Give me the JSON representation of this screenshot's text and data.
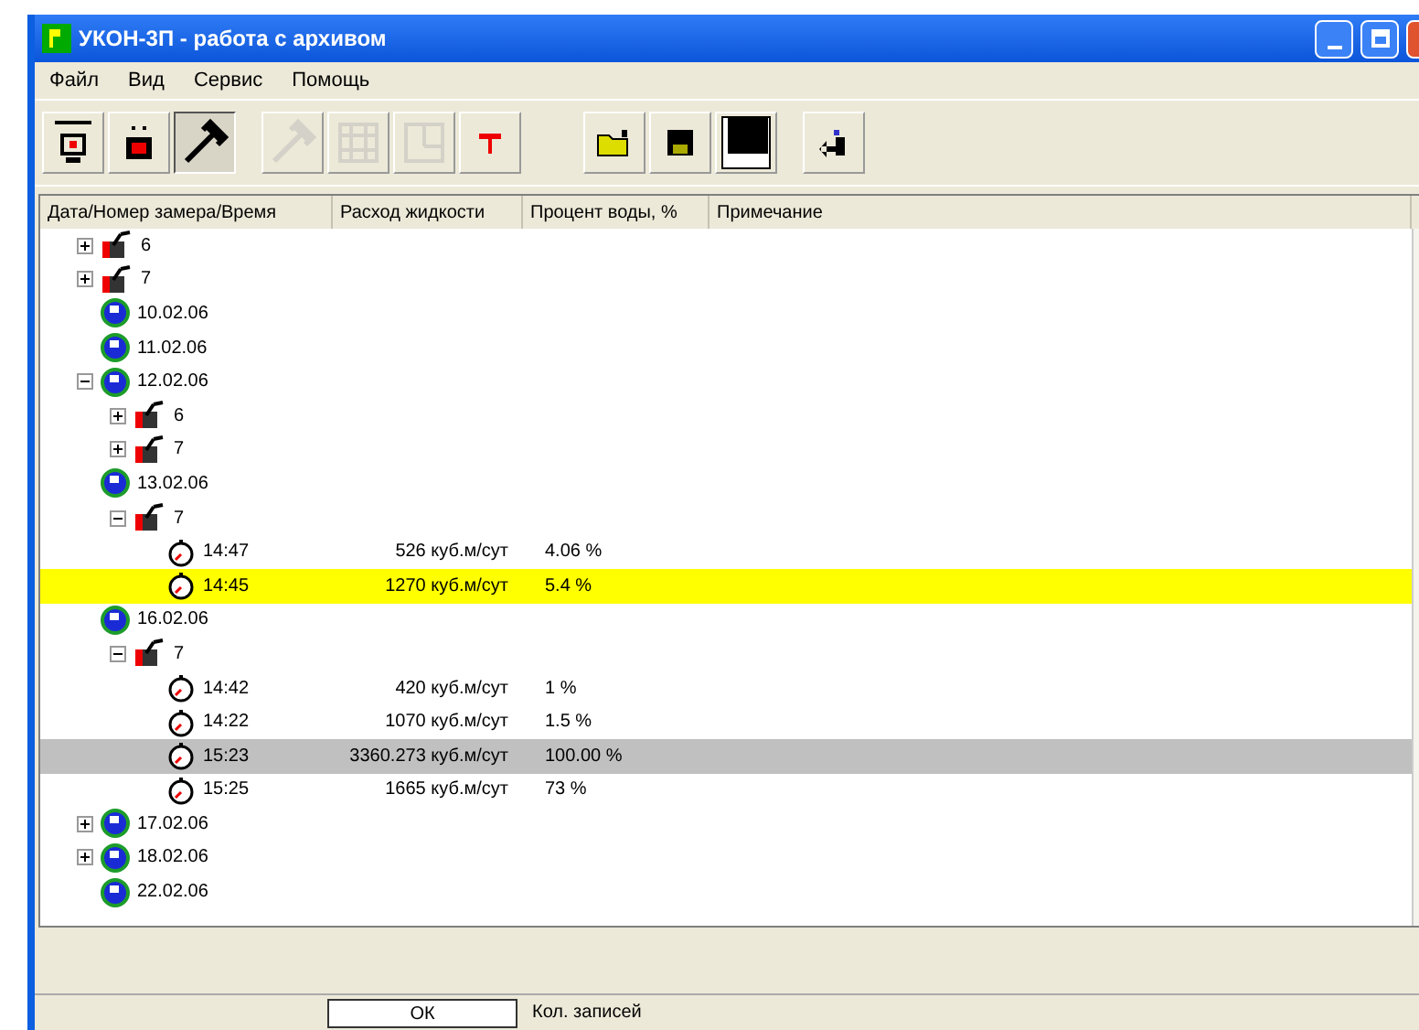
{
  "window": {
    "title": "УКОН-3П - работа с архивом"
  },
  "menu": [
    "Файл",
    "Вид",
    "Сервис",
    "Помощь"
  ],
  "toolbar": [
    {
      "kind": "device",
      "pressed": false,
      "disabled": false
    },
    {
      "kind": "battery",
      "pressed": false,
      "disabled": false
    },
    {
      "kind": "tools",
      "pressed": true,
      "disabled": false
    },
    {
      "kind": "tools",
      "pressed": false,
      "disabled": true
    },
    {
      "kind": "grid",
      "pressed": false,
      "disabled": true
    },
    {
      "kind": "frame",
      "pressed": false,
      "disabled": true
    },
    {
      "kind": "text",
      "pressed": false,
      "disabled": false
    },
    {
      "kind": "open",
      "pressed": false,
      "disabled": false
    },
    {
      "kind": "save",
      "pressed": false,
      "disabled": false
    },
    {
      "kind": "screen",
      "pressed": false,
      "disabled": false
    },
    {
      "kind": "exit",
      "pressed": false,
      "disabled": false
    }
  ],
  "table": {
    "columns": [
      "Дата/Номер замера/Время",
      "Расход жидкости",
      "Процент воды, %",
      "Примечание"
    ],
    "rows": [
      {
        "kind": "folder",
        "label": "6",
        "expanded": false
      },
      {
        "kind": "folder",
        "label": "7",
        "expanded": false
      },
      {
        "kind": "date",
        "label": "10.02.06"
      },
      {
        "kind": "date",
        "label": "11.02.06"
      },
      {
        "kind": "date",
        "label": "12.02.06",
        "expanded": true,
        "children": [
          {
            "kind": "folder",
            "label": "6",
            "expanded": false
          },
          {
            "kind": "folder",
            "label": "7",
            "expanded": false
          }
        ]
      },
      {
        "kind": "date",
        "label": "13.02.06",
        "children": [
          {
            "kind": "folder",
            "label": "7",
            "expanded": true,
            "children": [
              {
                "kind": "record",
                "label": "14:47",
                "flow": "526 куб.м/сут",
                "water": "4.06 %",
                "marked": false,
                "selected": false
              },
              {
                "kind": "record",
                "label": "14:45",
                "flow": "1270 куб.м/сут",
                "water": "5.4 %",
                "marked": true,
                "selected": false
              }
            ]
          }
        ]
      },
      {
        "kind": "date",
        "label": "16.02.06",
        "children": [
          {
            "kind": "folder",
            "label": "7",
            "expanded": true,
            "children": [
              {
                "kind": "record",
                "label": "14:42",
                "flow": "420 куб.м/сут",
                "water": "1 %",
                "marked": false,
                "selected": false
              },
              {
                "kind": "record",
                "label": "14:22",
                "flow": "1070 куб.м/сут",
                "water": "1.5 %",
                "marked": false,
                "selected": false
              },
              {
                "kind": "record",
                "label": "15:23",
                "flow": "3360.273 куб.м/сут",
                "water": "100.00 %",
                "marked": false,
                "selected": true
              },
              {
                "kind": "record",
                "label": "15:25",
                "flow": "1665 куб.м/сут",
                "water": "73 %",
                "marked": false,
                "selected": false
              }
            ]
          }
        ]
      },
      {
        "kind": "date",
        "label": "17.02.06",
        "expanded": false
      },
      {
        "kind": "date",
        "label": "18.02.06",
        "expanded": false
      },
      {
        "kind": "date",
        "label": "22.02.06"
      }
    ]
  },
  "status_bar": [
    "ОК",
    "Кол. записей"
  ]
}
